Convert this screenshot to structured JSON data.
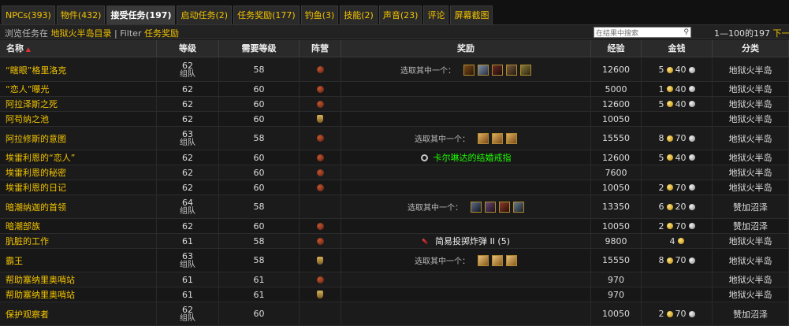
{
  "tabs": [
    {
      "label": "NPCs(393)",
      "active": false
    },
    {
      "label": "物件(432)",
      "active": false
    },
    {
      "label": "接受任务(197)",
      "active": true
    },
    {
      "label": "启动任务(2)",
      "active": false
    },
    {
      "label": "任务奖励(177)",
      "active": false
    },
    {
      "label": "钓鱼(3)",
      "active": false
    },
    {
      "label": "技能(2)",
      "active": false
    },
    {
      "label": "声音(23)",
      "active": false
    },
    {
      "label": "评论",
      "active": false
    },
    {
      "label": "屏幕截图",
      "active": false
    }
  ],
  "browse": {
    "prefix": "浏览任务在",
    "zone": "地狱火半岛目录",
    "separator": "|",
    "filter_label": "Filter",
    "filter_value": "任务奖励"
  },
  "search": {
    "placeholder": "在结果中搜索",
    "icon": "search-icon"
  },
  "pager": {
    "range": "1—100的197",
    "next": "下一个 〉"
  },
  "columns": [
    "名称",
    "等级",
    "需要等级",
    "阵营",
    "奖励",
    "经验",
    "金钱",
    "分类"
  ],
  "sort_indicator": "▲",
  "choose_text": "选取其中一个：",
  "rows": [
    {
      "name": "“瞎眼”格里洛克",
      "level": "62",
      "group": "组队",
      "req": "58",
      "faction": "horde",
      "reward_type": "choose",
      "icons": [
        "i1",
        "i2",
        "i3",
        "i4",
        "i5"
      ],
      "xp": "12600",
      "gold": "5",
      "silver": "40",
      "category": "地狱火半岛"
    },
    {
      "name": "“恋人”曝光",
      "level": "62",
      "group": "",
      "req": "60",
      "faction": "horde",
      "reward_type": "none",
      "icons": [],
      "xp": "5000",
      "gold": "1",
      "silver": "40",
      "category": "地狱火半岛"
    },
    {
      "name": "阿拉泽斯之死",
      "level": "62",
      "group": "",
      "req": "60",
      "faction": "horde",
      "reward_type": "none",
      "icons": [],
      "xp": "12600",
      "gold": "5",
      "silver": "40",
      "category": "地狱火半岛"
    },
    {
      "name": "阿苟纳之池",
      "level": "62",
      "group": "",
      "req": "60",
      "faction": "ally",
      "reward_type": "none",
      "icons": [],
      "xp": "10050",
      "gold": "",
      "silver": "",
      "category": "地狱火半岛"
    },
    {
      "name": "阿拉修斯的意图",
      "level": "63",
      "group": "组队",
      "req": "58",
      "faction": "horde",
      "reward_type": "choose",
      "icons": [
        "s1",
        "s1",
        "s1"
      ],
      "xp": "15550",
      "gold": "8",
      "silver": "70",
      "category": "地狱火半岛"
    },
    {
      "name": "埃雷利恩的“恋人”",
      "level": "62",
      "group": "",
      "req": "60",
      "faction": "horde",
      "reward_type": "item",
      "item": "卡尔琳达的结婚戒指",
      "item_icon": "ring-icon",
      "item_color": "green",
      "icons": [],
      "xp": "12600",
      "gold": "5",
      "silver": "40",
      "category": "地狱火半岛"
    },
    {
      "name": "埃雷利恩的秘密",
      "level": "62",
      "group": "",
      "req": "60",
      "faction": "horde",
      "reward_type": "none",
      "icons": [],
      "xp": "7600",
      "gold": "",
      "silver": "",
      "category": "地狱火半岛"
    },
    {
      "name": "埃雷利恩的日记",
      "level": "62",
      "group": "",
      "req": "60",
      "faction": "horde",
      "reward_type": "none",
      "icons": [],
      "xp": "10050",
      "gold": "2",
      "silver": "70",
      "category": "地狱火半岛"
    },
    {
      "name": "暗潮纳迦的首领",
      "level": "64",
      "group": "组队",
      "req": "58",
      "faction": "none",
      "reward_type": "choose",
      "icons": [
        "b1",
        "b2",
        "b3",
        "b4"
      ],
      "xp": "13350",
      "gold": "6",
      "silver": "20",
      "category": "赞加沼泽"
    },
    {
      "name": "暗潮部族",
      "level": "62",
      "group": "",
      "req": "60",
      "faction": "horde",
      "reward_type": "none",
      "icons": [],
      "xp": "10050",
      "gold": "2",
      "silver": "70",
      "category": "赞加沼泽"
    },
    {
      "name": "肮脏的工作",
      "level": "61",
      "group": "",
      "req": "58",
      "faction": "horde",
      "reward_type": "item",
      "item": "简易投掷炸弹 II (5)",
      "item_icon": "bomb-icon",
      "item_color": "white",
      "icons": [],
      "xp": "9800",
      "gold": "4",
      "silver": "",
      "category": "地狱火半岛"
    },
    {
      "name": "霸王",
      "level": "63",
      "group": "组队",
      "req": "58",
      "faction": "ally",
      "reward_type": "choose",
      "icons": [
        "r1",
        "r1",
        "r1"
      ],
      "xp": "15550",
      "gold": "8",
      "silver": "70",
      "category": "地狱火半岛"
    },
    {
      "name": "帮助塞纳里奥哨站",
      "level": "61",
      "group": "",
      "req": "61",
      "faction": "horde",
      "reward_type": "none",
      "icons": [],
      "xp": "970",
      "gold": "",
      "silver": "",
      "category": "地狱火半岛"
    },
    {
      "name": "帮助塞纳里奥哨站",
      "level": "61",
      "group": "",
      "req": "61",
      "faction": "ally",
      "reward_type": "none",
      "icons": [],
      "xp": "970",
      "gold": "",
      "silver": "",
      "category": "地狱火半岛"
    },
    {
      "name": "保护观察者",
      "level": "62",
      "group": "组队",
      "req": "60",
      "faction": "none",
      "reward_type": "none",
      "icons": [],
      "xp": "10050",
      "gold": "2",
      "silver": "70",
      "category": "赞加沼泽"
    }
  ]
}
